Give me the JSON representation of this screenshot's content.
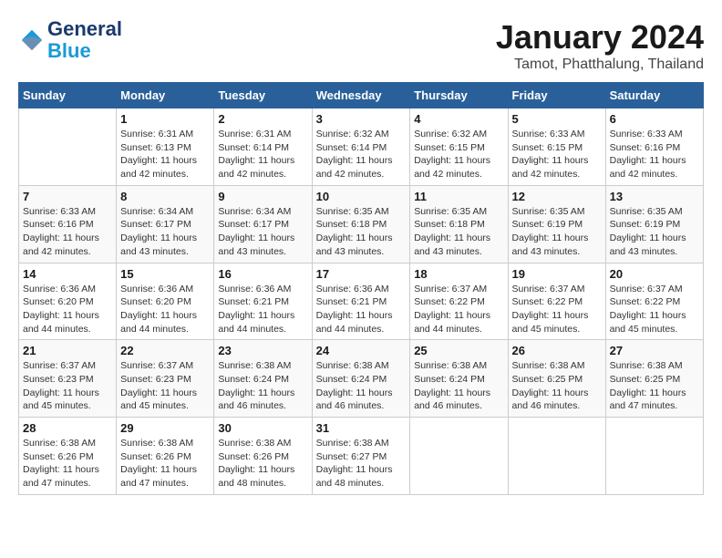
{
  "header": {
    "logo_line1": "General",
    "logo_line2": "Blue",
    "month": "January 2024",
    "location": "Tamot, Phatthalung, Thailand"
  },
  "weekdays": [
    "Sunday",
    "Monday",
    "Tuesday",
    "Wednesday",
    "Thursday",
    "Friday",
    "Saturday"
  ],
  "weeks": [
    [
      {
        "day": "",
        "sunrise": "",
        "sunset": "",
        "daylight": ""
      },
      {
        "day": "1",
        "sunrise": "Sunrise: 6:31 AM",
        "sunset": "Sunset: 6:13 PM",
        "daylight": "Daylight: 11 hours and 42 minutes."
      },
      {
        "day": "2",
        "sunrise": "Sunrise: 6:31 AM",
        "sunset": "Sunset: 6:14 PM",
        "daylight": "Daylight: 11 hours and 42 minutes."
      },
      {
        "day": "3",
        "sunrise": "Sunrise: 6:32 AM",
        "sunset": "Sunset: 6:14 PM",
        "daylight": "Daylight: 11 hours and 42 minutes."
      },
      {
        "day": "4",
        "sunrise": "Sunrise: 6:32 AM",
        "sunset": "Sunset: 6:15 PM",
        "daylight": "Daylight: 11 hours and 42 minutes."
      },
      {
        "day": "5",
        "sunrise": "Sunrise: 6:33 AM",
        "sunset": "Sunset: 6:15 PM",
        "daylight": "Daylight: 11 hours and 42 minutes."
      },
      {
        "day": "6",
        "sunrise": "Sunrise: 6:33 AM",
        "sunset": "Sunset: 6:16 PM",
        "daylight": "Daylight: 11 hours and 42 minutes."
      }
    ],
    [
      {
        "day": "7",
        "sunrise": "Sunrise: 6:33 AM",
        "sunset": "Sunset: 6:16 PM",
        "daylight": "Daylight: 11 hours and 42 minutes."
      },
      {
        "day": "8",
        "sunrise": "Sunrise: 6:34 AM",
        "sunset": "Sunset: 6:17 PM",
        "daylight": "Daylight: 11 hours and 43 minutes."
      },
      {
        "day": "9",
        "sunrise": "Sunrise: 6:34 AM",
        "sunset": "Sunset: 6:17 PM",
        "daylight": "Daylight: 11 hours and 43 minutes."
      },
      {
        "day": "10",
        "sunrise": "Sunrise: 6:35 AM",
        "sunset": "Sunset: 6:18 PM",
        "daylight": "Daylight: 11 hours and 43 minutes."
      },
      {
        "day": "11",
        "sunrise": "Sunrise: 6:35 AM",
        "sunset": "Sunset: 6:18 PM",
        "daylight": "Daylight: 11 hours and 43 minutes."
      },
      {
        "day": "12",
        "sunrise": "Sunrise: 6:35 AM",
        "sunset": "Sunset: 6:19 PM",
        "daylight": "Daylight: 11 hours and 43 minutes."
      },
      {
        "day": "13",
        "sunrise": "Sunrise: 6:35 AM",
        "sunset": "Sunset: 6:19 PM",
        "daylight": "Daylight: 11 hours and 43 minutes."
      }
    ],
    [
      {
        "day": "14",
        "sunrise": "Sunrise: 6:36 AM",
        "sunset": "Sunset: 6:20 PM",
        "daylight": "Daylight: 11 hours and 44 minutes."
      },
      {
        "day": "15",
        "sunrise": "Sunrise: 6:36 AM",
        "sunset": "Sunset: 6:20 PM",
        "daylight": "Daylight: 11 hours and 44 minutes."
      },
      {
        "day": "16",
        "sunrise": "Sunrise: 6:36 AM",
        "sunset": "Sunset: 6:21 PM",
        "daylight": "Daylight: 11 hours and 44 minutes."
      },
      {
        "day": "17",
        "sunrise": "Sunrise: 6:36 AM",
        "sunset": "Sunset: 6:21 PM",
        "daylight": "Daylight: 11 hours and 44 minutes."
      },
      {
        "day": "18",
        "sunrise": "Sunrise: 6:37 AM",
        "sunset": "Sunset: 6:22 PM",
        "daylight": "Daylight: 11 hours and 44 minutes."
      },
      {
        "day": "19",
        "sunrise": "Sunrise: 6:37 AM",
        "sunset": "Sunset: 6:22 PM",
        "daylight": "Daylight: 11 hours and 45 minutes."
      },
      {
        "day": "20",
        "sunrise": "Sunrise: 6:37 AM",
        "sunset": "Sunset: 6:22 PM",
        "daylight": "Daylight: 11 hours and 45 minutes."
      }
    ],
    [
      {
        "day": "21",
        "sunrise": "Sunrise: 6:37 AM",
        "sunset": "Sunset: 6:23 PM",
        "daylight": "Daylight: 11 hours and 45 minutes."
      },
      {
        "day": "22",
        "sunrise": "Sunrise: 6:37 AM",
        "sunset": "Sunset: 6:23 PM",
        "daylight": "Daylight: 11 hours and 45 minutes."
      },
      {
        "day": "23",
        "sunrise": "Sunrise: 6:38 AM",
        "sunset": "Sunset: 6:24 PM",
        "daylight": "Daylight: 11 hours and 46 minutes."
      },
      {
        "day": "24",
        "sunrise": "Sunrise: 6:38 AM",
        "sunset": "Sunset: 6:24 PM",
        "daylight": "Daylight: 11 hours and 46 minutes."
      },
      {
        "day": "25",
        "sunrise": "Sunrise: 6:38 AM",
        "sunset": "Sunset: 6:24 PM",
        "daylight": "Daylight: 11 hours and 46 minutes."
      },
      {
        "day": "26",
        "sunrise": "Sunrise: 6:38 AM",
        "sunset": "Sunset: 6:25 PM",
        "daylight": "Daylight: 11 hours and 46 minutes."
      },
      {
        "day": "27",
        "sunrise": "Sunrise: 6:38 AM",
        "sunset": "Sunset: 6:25 PM",
        "daylight": "Daylight: 11 hours and 47 minutes."
      }
    ],
    [
      {
        "day": "28",
        "sunrise": "Sunrise: 6:38 AM",
        "sunset": "Sunset: 6:26 PM",
        "daylight": "Daylight: 11 hours and 47 minutes."
      },
      {
        "day": "29",
        "sunrise": "Sunrise: 6:38 AM",
        "sunset": "Sunset: 6:26 PM",
        "daylight": "Daylight: 11 hours and 47 minutes."
      },
      {
        "day": "30",
        "sunrise": "Sunrise: 6:38 AM",
        "sunset": "Sunset: 6:26 PM",
        "daylight": "Daylight: 11 hours and 48 minutes."
      },
      {
        "day": "31",
        "sunrise": "Sunrise: 6:38 AM",
        "sunset": "Sunset: 6:27 PM",
        "daylight": "Daylight: 11 hours and 48 minutes."
      },
      {
        "day": "",
        "sunrise": "",
        "sunset": "",
        "daylight": ""
      },
      {
        "day": "",
        "sunrise": "",
        "sunset": "",
        "daylight": ""
      },
      {
        "day": "",
        "sunrise": "",
        "sunset": "",
        "daylight": ""
      }
    ]
  ]
}
